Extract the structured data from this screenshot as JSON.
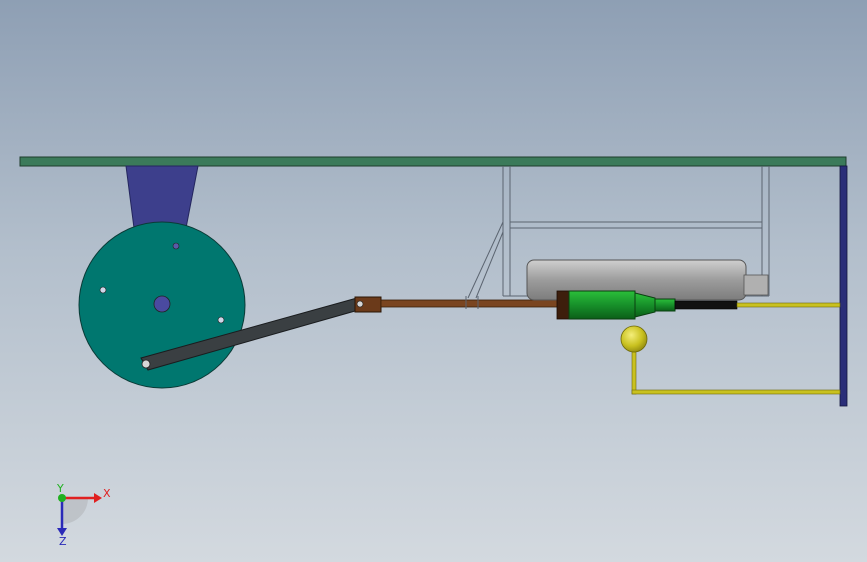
{
  "triad": {
    "x_label": "X",
    "y_label": "Y",
    "z_label": "Z",
    "x_color": "#e02020",
    "y_color": "#20b020",
    "z_color": "#2a2ab8"
  },
  "colors": {
    "plate": "#3b7a5a",
    "bracket": "#3d3f8c",
    "wheel": "#00776f",
    "hub": "#4a4aa0",
    "crank_arm": "#3a3f42",
    "connecting_rod": "#7a4520",
    "green_body": "#1f8f2a",
    "cylinder": "#a8a8a8",
    "yellow_pipe": "#c9c11f",
    "post": "#2a2e78"
  }
}
